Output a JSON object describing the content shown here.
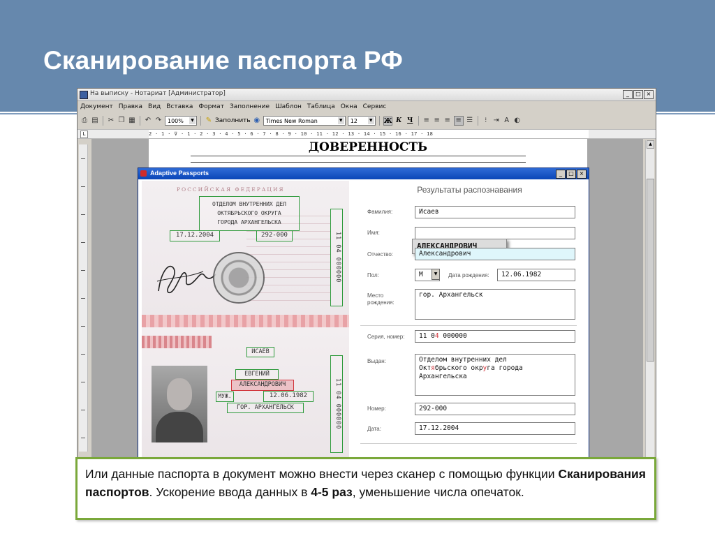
{
  "slide": {
    "title": "Сканирование паспорта РФ"
  },
  "word": {
    "window_title": "На выписку - Нотариат [Администратор]",
    "menu": [
      "Документ",
      "Правка",
      "Вид",
      "Вставка",
      "Формат",
      "Заполнение",
      "Шаблон",
      "Таблица",
      "Окна",
      "Сервис"
    ],
    "toolbar": {
      "zoom": "100%",
      "fill_label": "Заполнить",
      "font_name": "Times New Roman",
      "font_size": "12",
      "bold": "Ж",
      "italic": "К",
      "underline": "Ч"
    },
    "ruler_text": "2 · 1 · ⊽ · 1 · 2 · 3 · 4 · 5 · 6 · 7 · 8 · 9 · 10 · 11 · 12 · 13 · 14 · 15 · 16 · 17 · 18",
    "document_heading": "ДОВЕРЕННОСТЬ"
  },
  "ap": {
    "title": "Adaptive Passports",
    "passport": {
      "header": "РОССИЙСКАЯ ФЕДЕРАЦИЯ",
      "issuer": "ОТДЕЛОМ ВНУТРЕННИХ ДЕЛ\nОКТЯБРЬСКОГО ОКРУГА\nГОРОДА АРХАНГЕЛЬСКА",
      "issue_date": "17.12.2004",
      "division_code": "292-000",
      "series_vertical": "11 04 000000",
      "surname": "ИСАЕВ",
      "name": "ЕВГЕНИЙ",
      "patronymic": "АЛЕКСАНДРОВИЧ",
      "sex": "МУЖ.",
      "birth_date": "12.06.1982",
      "birth_place": "ГОР. АРХАНГЕЛЬСК"
    },
    "results": {
      "title": "Результаты распознавания",
      "surname_label": "Фамилия:",
      "surname_value": "Исаев",
      "name_label": "Имя:",
      "name_value": "АЛЕКСАНДРОВИЧ",
      "patronymic_label": "Отчество:",
      "patronymic_value": "Александрович",
      "sex_label": "Пол:",
      "sex_value": "М",
      "birthdate_label": "Дата рождения:",
      "birthdate_value": "12.06.1982",
      "birthplace_label": "Место\nрождения:",
      "birthplace_value": "гор. Архангельск",
      "series_label": "Серия, номер:",
      "series_value_a": "11 0",
      "series_value_red": "4",
      "series_value_b": " 000000",
      "issued_label": "Выдан:",
      "issued_l1": "Отделом внутренних дел",
      "issued_l2_a": "Окт",
      "issued_l2_red1": "я",
      "issued_l2_b": "брьского окр",
      "issued_l2_red2": "у",
      "issued_l2_c": "га города",
      "issued_l3": "Архангельска",
      "number_label": "Номер:",
      "number_value": "292-000",
      "date_label": "Дата:",
      "date_value": "17.12.2004"
    }
  },
  "caption": {
    "part1": "Или данные паспорта в документ можно внести через сканер с помощью функции ",
    "bold1": "Сканирования паспортов",
    "part2": ". Ускорение ввода данных в ",
    "bold2": "4-5 раз",
    "part3": ", уменьшение числа опечаток."
  },
  "colors": {
    "header_bg": "#6688ad",
    "caption_border": "#7aa83a",
    "detect_box": "#2e9a3b",
    "detect_box_alert": "#d1333a",
    "dialog_titlebar": "#0a46b8"
  }
}
